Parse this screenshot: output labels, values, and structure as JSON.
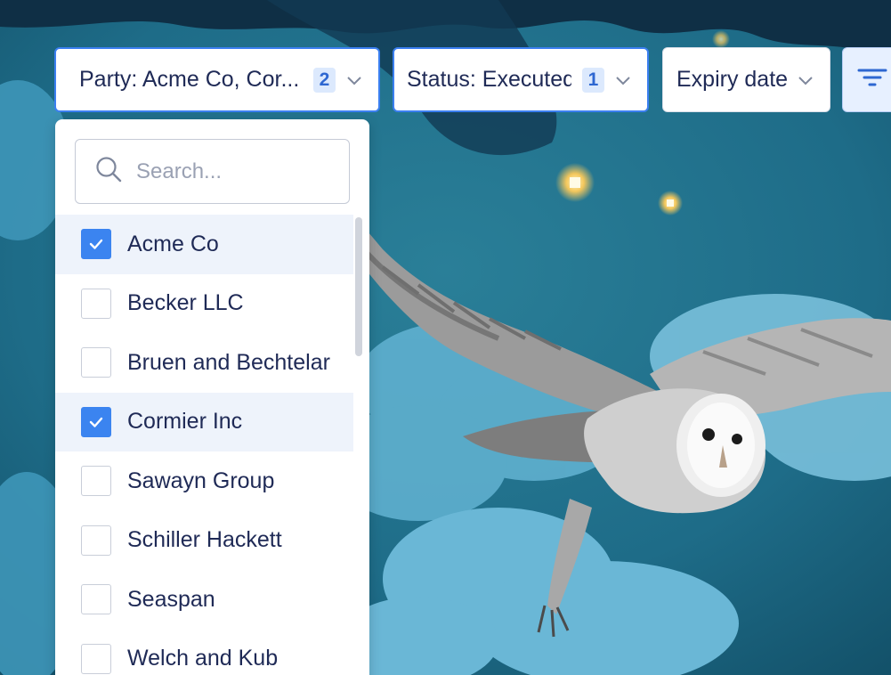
{
  "filters": {
    "party": {
      "label": "Party: Acme Co, Cor...",
      "count": "2",
      "icon": "chevron-down-icon"
    },
    "status": {
      "label": "Status: Executed",
      "count": "1",
      "icon": "chevron-down-icon"
    },
    "expiry": {
      "label": "Expiry date",
      "icon": "chevron-down-icon"
    },
    "more_filters": {
      "icon": "filter-lines-icon"
    }
  },
  "dropdown": {
    "search": {
      "placeholder": "Search...",
      "value": "",
      "icon": "search-icon"
    },
    "options": [
      {
        "label": "Acme Co",
        "checked": true
      },
      {
        "label": "Becker LLC",
        "checked": false
      },
      {
        "label": "Bruen and Bechtelar",
        "checked": false
      },
      {
        "label": "Cormier Inc",
        "checked": true
      },
      {
        "label": "Sawayn Group",
        "checked": false
      },
      {
        "label": "Schiller Hackett",
        "checked": false
      },
      {
        "label": "Seaspan",
        "checked": false
      },
      {
        "label": "Welch and Kub",
        "checked": false
      }
    ]
  },
  "colors": {
    "accent": "#3b84f0",
    "text": "#1f2a56",
    "sky": "#2f8fa9"
  }
}
